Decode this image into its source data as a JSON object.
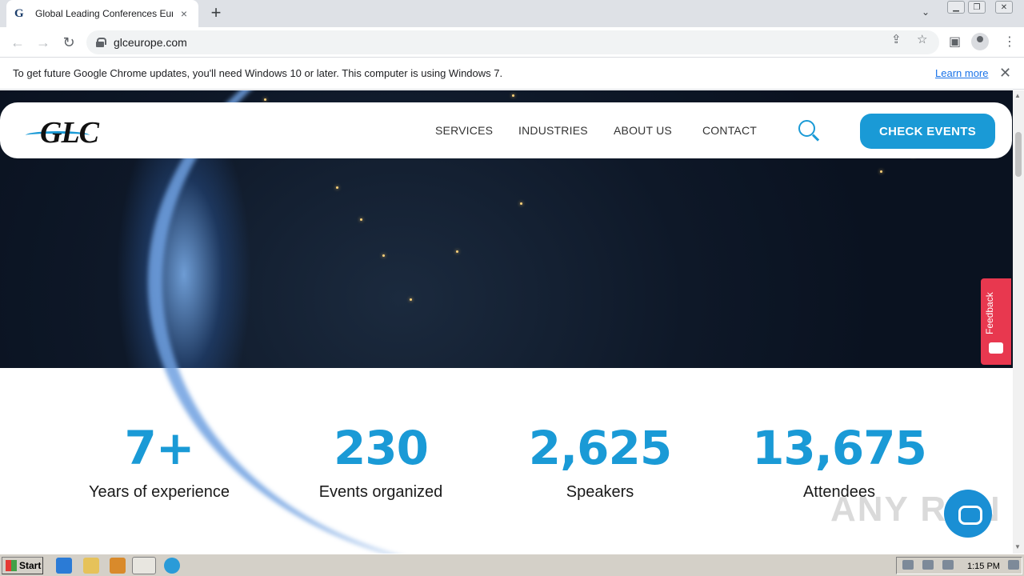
{
  "browser": {
    "tab_title": "Global Leading Conferences Europe",
    "tab_favicon": "G",
    "new_tab": "+",
    "tab_close": "×",
    "url": "glceurope.com"
  },
  "infobar": {
    "message": "To get future Google Chrome updates, you'll need Windows 10 or later. This computer is using Windows 7.",
    "link": "Learn more",
    "close": "✕"
  },
  "header": {
    "logo": "GLC",
    "nav": [
      "SERVICES",
      "INDUSTRIES",
      "ABOUT US",
      "CONTACT"
    ],
    "cta": "CHECK EVENTS"
  },
  "stats": [
    {
      "value": "7+",
      "label": "Years of experience"
    },
    {
      "value": "230",
      "label": "Events organized"
    },
    {
      "value": "2,625",
      "label": "Speakers"
    },
    {
      "value": "13,675",
      "label": "Attendees"
    }
  ],
  "feedback": {
    "label": "Feedback"
  },
  "watermark": "ANY RUN",
  "taskbar": {
    "start": "Start",
    "clock": "1:15 PM"
  },
  "colors": {
    "accent": "#1a9ad6",
    "feedback": "#e8384f"
  }
}
